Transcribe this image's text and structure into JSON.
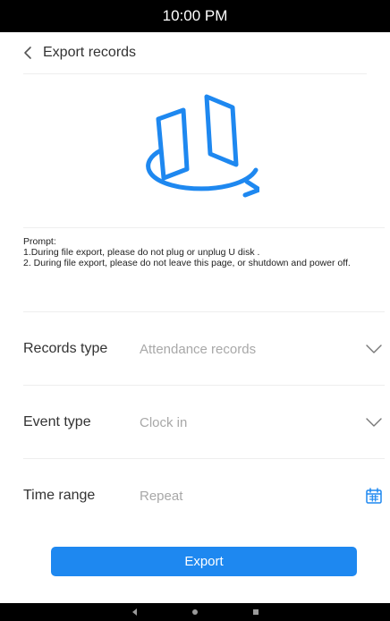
{
  "status_bar": {
    "time": "10:00 PM"
  },
  "header": {
    "title": "Export records"
  },
  "hero": {
    "icon": "export-transfer-icon"
  },
  "prompt": {
    "heading": "Prompt:",
    "line1": "1.During file export, please do not plug or unplug U disk .",
    "line2": "2. During file export, please do not leave this page, or  shutdown and power off."
  },
  "form": {
    "records_type": {
      "label": "Records type",
      "value": "Attendance records",
      "icon": "chevron-down-icon"
    },
    "event_type": {
      "label": "Event type",
      "value": "Clock in",
      "icon": "chevron-down-icon"
    },
    "time_range": {
      "label": "Time range",
      "value": "Repeat",
      "icon": "calendar-icon"
    }
  },
  "actions": {
    "export_label": "Export"
  },
  "colors": {
    "accent": "#1e88f0",
    "status_bar_bg": "#000000",
    "placeholder_text": "#a8a8a8"
  }
}
